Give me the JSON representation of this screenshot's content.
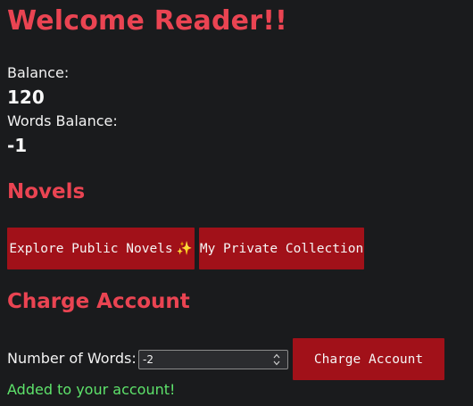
{
  "header": {
    "title": "Welcome Reader!!"
  },
  "account": {
    "balance_label": "Balance:",
    "balance_value": "120",
    "words_balance_label": "Words Balance:",
    "words_balance_value": "-1"
  },
  "novels": {
    "section_title": "Novels",
    "explore_button_label": "Explore Public Novels",
    "explore_button_icon": "✨",
    "private_collection_button_label": "My Private Collection"
  },
  "charge": {
    "section_title": "Charge Account",
    "words_field_label": "Number of Words:",
    "words_field_value": "-2",
    "submit_button_label": "Charge Account",
    "success_message": "Added to your account!"
  },
  "colors": {
    "background": "#1a1b1d",
    "accent": "#ea4452",
    "button": "#a11119",
    "success": "#5ee36b"
  },
  "icons": {
    "sparkle": "sparkles-icon",
    "spinner_up": "chevron-up-icon",
    "spinner_down": "chevron-down-icon"
  }
}
